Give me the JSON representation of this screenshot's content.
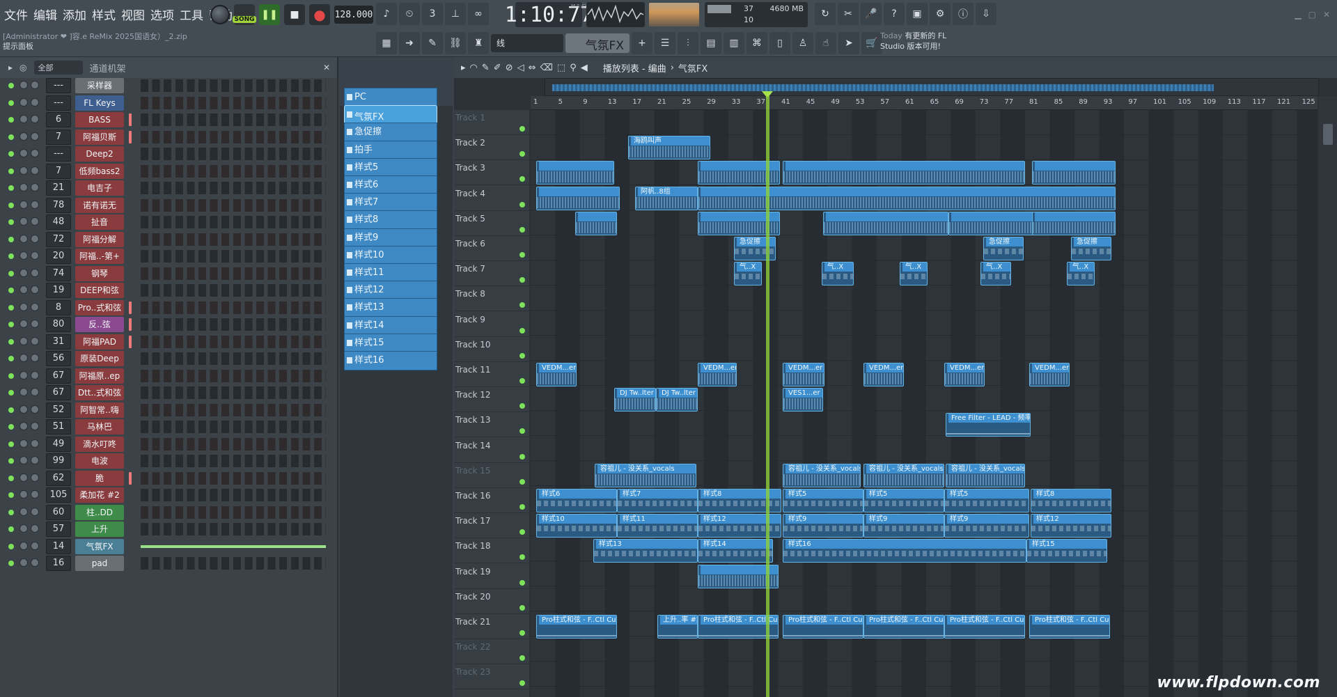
{
  "menu": [
    "文件",
    "编辑",
    "添加",
    "样式",
    "视图",
    "选项",
    "工具",
    "帮助"
  ],
  "project": {
    "user": "[Administrator ❤",
    "file": "]容.e ReMix 2025国语女）_2.zip",
    "hint": "提示面板"
  },
  "transport": {
    "song_label": "SONG",
    "tempo": "128.000",
    "time": "1:10:77",
    "time_unit": "M:S:CS"
  },
  "cpu": {
    "value_a": "37",
    "memory": "4680 MB",
    "value_c": "10"
  },
  "toolbar2": {
    "snap": "线",
    "fx_select": "气氛FX"
  },
  "news": {
    "today": "Today",
    "line1": "有更新的 FL",
    "line2": "Studio 版本可用!"
  },
  "rack": {
    "filter": "全部",
    "title": "通道机架",
    "channels": [
      {
        "num": "---",
        "name": "采样器"
      },
      {
        "num": "---",
        "name": "FL Keys"
      },
      {
        "num": "6",
        "name": "BASS"
      },
      {
        "num": "7",
        "name": "阿福贝斯"
      },
      {
        "num": "---",
        "name": "Deep2"
      },
      {
        "num": "7",
        "name": "低频bass2"
      },
      {
        "num": "21",
        "name": "电吉子"
      },
      {
        "num": "78",
        "name": "诺有诺无"
      },
      {
        "num": "48",
        "name": "扯音"
      },
      {
        "num": "72",
        "name": "阿福分解"
      },
      {
        "num": "20",
        "name": "阿福..-第+"
      },
      {
        "num": "74",
        "name": "钢琴"
      },
      {
        "num": "19",
        "name": "DEEP和弦"
      },
      {
        "num": "8",
        "name": "Pro..式和弦"
      },
      {
        "num": "80",
        "name": "反..弦"
      },
      {
        "num": "31",
        "name": "阿福PAD"
      },
      {
        "num": "56",
        "name": "原装Deep"
      },
      {
        "num": "67",
        "name": "阿福原..ep"
      },
      {
        "num": "67",
        "name": "Dtt..式和弦"
      },
      {
        "num": "52",
        "name": "阿智常..嗨"
      },
      {
        "num": "51",
        "name": "马林巴"
      },
      {
        "num": "49",
        "name": "滴水叮咚"
      },
      {
        "num": "99",
        "name": "电波"
      },
      {
        "num": "62",
        "name": "脆"
      },
      {
        "num": "105",
        "name": "柔加花 #2"
      },
      {
        "num": "60",
        "name": "柱..DD"
      },
      {
        "num": "57",
        "name": "上升"
      },
      {
        "num": "14",
        "name": "气氛FX"
      },
      {
        "num": "16",
        "name": "pad"
      }
    ]
  },
  "patterns": [
    "PC",
    "气氛FX",
    "急促擦",
    "拍手",
    "样式5",
    "样式6",
    "样式7",
    "样式8",
    "样式9",
    "样式10",
    "样式11",
    "样式12",
    "样式13",
    "样式14",
    "样式15",
    "样式16"
  ],
  "playlist": {
    "title": "播放列表 - 编曲",
    "crumb": "气氛FX",
    "bars": [
      "1",
      "5",
      "9",
      "13",
      "17",
      "21",
      "25",
      "29",
      "33",
      "37",
      "41",
      "45",
      "49",
      "53",
      "57",
      "61",
      "65",
      "69",
      "73",
      "77",
      "81",
      "85",
      "89",
      "93",
      "97",
      "101",
      "105",
      "109",
      "113",
      "117",
      "121",
      "125"
    ],
    "tracks": [
      "Track 1",
      "Track 2",
      "Track 3",
      "Track 4",
      "Track 5",
      "Track 6",
      "Track 7",
      "Track 8",
      "Track 9",
      "Track 10",
      "Track 11",
      "Track 12",
      "Track 13",
      "Track 14",
      "Track 15",
      "Track 16",
      "Track 17",
      "Track 18",
      "Track 19",
      "Track 20",
      "Track 21",
      "Track 22",
      "Track 23"
    ],
    "clips": [
      {
        "label": "海鸥叫声"
      },
      {
        "label": "阿帆..8组"
      },
      {
        "label": "急促擦"
      },
      {
        "label": "急促擦"
      },
      {
        "label": "急促擦"
      },
      {
        "label": "气..X"
      },
      {
        "label": "气..X"
      },
      {
        "label": "气..X"
      },
      {
        "label": "气..X"
      },
      {
        "label": "气..X"
      },
      {
        "label": "VEDM...er 01"
      },
      {
        "label": "VEDM...er 01"
      },
      {
        "label": "VEDM...er 01"
      },
      {
        "label": "VEDM...er 01"
      },
      {
        "label": "VEDM...er 01"
      },
      {
        "label": "VEDM...er 01"
      },
      {
        "label": "DJ Tw..lter 5"
      },
      {
        "label": "DJ Tw..lter 5"
      },
      {
        "label": "VES1...er 002"
      },
      {
        "label": "Free Filter - LEAD - 频率"
      },
      {
        "label": "容祖儿 - 没关系_vocals"
      },
      {
        "label": "容祖儿 - 没关系_vocals"
      },
      {
        "label": "容祖儿 - 没关系_vocals"
      },
      {
        "label": "容祖儿 - 没关系_vocals"
      },
      {
        "label": "样式6"
      },
      {
        "label": "样式7"
      },
      {
        "label": "样式8"
      },
      {
        "label": "样式5"
      },
      {
        "label": "样式5"
      },
      {
        "label": "样式5"
      },
      {
        "label": "样式8"
      },
      {
        "label": "样式10"
      },
      {
        "label": "样式11"
      },
      {
        "label": "样式12"
      },
      {
        "label": "样式9"
      },
      {
        "label": "样式9"
      },
      {
        "label": "样式9"
      },
      {
        "label": "样式12"
      },
      {
        "label": "样式13"
      },
      {
        "label": "样式14"
      },
      {
        "label": "样式16"
      },
      {
        "label": "样式15"
      },
      {
        "label": "Pro柱式和弦 - F..Ctl Cutoff"
      },
      {
        "label": "上升..率 #2"
      },
      {
        "label": "Pro柱式和弦 - F..Ctl Cutoff"
      },
      {
        "label": "Pro柱式和弦 - F..Ctl Cutoff"
      },
      {
        "label": "Pro柱式和弦 - F..Ctl Cutoff"
      },
      {
        "label": "Pro柱式和弦 - F..Ctl Cutoff"
      },
      {
        "label": "Pro柱式和弦 - F..Ctl Cutoff"
      }
    ]
  },
  "watermark": "www.flpdown.com"
}
